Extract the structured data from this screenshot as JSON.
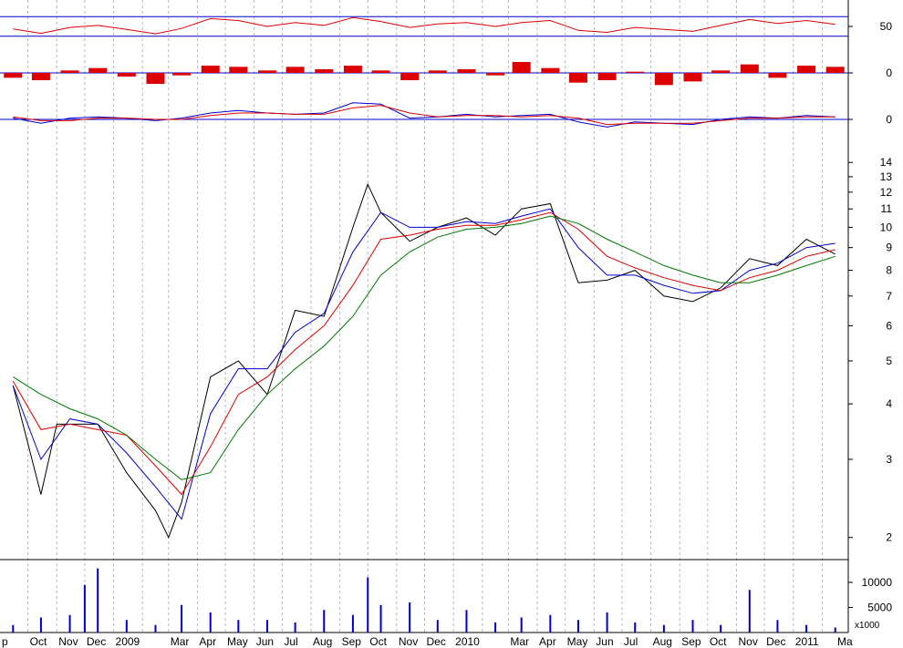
{
  "chart_data": [
    {
      "panel": "rsi",
      "type": "line",
      "y_ticks": [
        50
      ],
      "ylim": [
        0,
        100
      ],
      "reference_levels": [
        30,
        70
      ],
      "series": [
        {
          "color": "#dd0000",
          "x": [
            "2008-09-15",
            "2008-10-15",
            "2008-11-15",
            "2008-12-15",
            "2009-01-15",
            "2009-02-15",
            "2009-03-15",
            "2009-04-15",
            "2009-05-15",
            "2009-06-15",
            "2009-07-15",
            "2009-08-15",
            "2009-09-15",
            "2009-10-15",
            "2009-11-15",
            "2009-12-15",
            "2010-01-15",
            "2010-02-15",
            "2010-03-15",
            "2010-04-15",
            "2010-05-15",
            "2010-06-15",
            "2010-07-15",
            "2010-08-15",
            "2010-09-15",
            "2010-10-15",
            "2010-11-15",
            "2010-12-15",
            "2011-01-15",
            "2011-02-15"
          ],
          "values": [
            45,
            36,
            48,
            52,
            44,
            35,
            46,
            66,
            62,
            50,
            58,
            52,
            68,
            60,
            48,
            55,
            58,
            50,
            58,
            62,
            42,
            38,
            48,
            44,
            40,
            52,
            64,
            56,
            62,
            54
          ]
        }
      ]
    },
    {
      "panel": "macd-histogram",
      "type": "bar",
      "y_ticks": [
        0
      ],
      "ylim": [
        -1.5,
        1.5
      ],
      "series": [
        {
          "color": "#dd0000",
          "x": [
            "2008-09-15",
            "2008-10-15",
            "2008-11-15",
            "2008-12-15",
            "2009-01-15",
            "2009-02-15",
            "2009-03-15",
            "2009-04-15",
            "2009-05-15",
            "2009-06-15",
            "2009-07-15",
            "2009-08-15",
            "2009-09-15",
            "2009-10-15",
            "2009-11-15",
            "2009-12-15",
            "2010-01-15",
            "2010-02-15",
            "2010-03-15",
            "2010-04-15",
            "2010-05-15",
            "2010-06-15",
            "2010-07-15",
            "2010-08-15",
            "2010-09-15",
            "2010-10-15",
            "2010-11-15",
            "2010-12-15",
            "2011-01-15",
            "2011-02-15"
          ],
          "values": [
            -0.4,
            -0.6,
            0.2,
            0.4,
            -0.3,
            -0.9,
            -0.2,
            0.6,
            0.5,
            0.2,
            0.5,
            0.3,
            0.6,
            0.2,
            -0.6,
            0.2,
            0.3,
            -0.2,
            0.9,
            0.4,
            -0.8,
            -0.6,
            0.1,
            -1.0,
            -0.7,
            0.2,
            0.7,
            -0.4,
            0.6,
            0.5
          ]
        }
      ]
    },
    {
      "panel": "macd",
      "type": "line",
      "y_ticks": [
        0
      ],
      "ylim": [
        -1,
        2
      ],
      "series": [
        {
          "color": "#0000cc",
          "x": [
            "2008-09-15",
            "2008-10-15",
            "2008-11-15",
            "2008-12-15",
            "2009-01-15",
            "2009-02-15",
            "2009-03-15",
            "2009-04-15",
            "2009-05-15",
            "2009-06-15",
            "2009-07-15",
            "2009-08-15",
            "2009-09-15",
            "2009-10-15",
            "2009-11-15",
            "2009-12-15",
            "2010-01-15",
            "2010-02-15",
            "2010-03-15",
            "2010-04-15",
            "2010-05-15",
            "2010-06-15",
            "2010-07-15",
            "2010-08-15",
            "2010-09-15",
            "2010-10-15",
            "2010-11-15",
            "2010-12-15",
            "2011-01-15",
            "2011-02-15"
          ],
          "values": [
            0.1,
            -0.3,
            0.1,
            0.2,
            0.1,
            -0.1,
            0.1,
            0.5,
            0.7,
            0.5,
            0.4,
            0.5,
            1.3,
            1.2,
            0.1,
            0.2,
            0.4,
            0.2,
            0.3,
            0.4,
            -0.2,
            -0.6,
            -0.2,
            -0.3,
            -0.4,
            0.0,
            0.2,
            0.1,
            0.3,
            0.2
          ]
        },
        {
          "color": "#dd0000",
          "x": [
            "2008-09-15",
            "2008-10-15",
            "2008-11-15",
            "2008-12-15",
            "2009-01-15",
            "2009-02-15",
            "2009-03-15",
            "2009-04-15",
            "2009-05-15",
            "2009-06-15",
            "2009-07-15",
            "2009-08-15",
            "2009-09-15",
            "2009-10-15",
            "2009-11-15",
            "2009-12-15",
            "2010-01-15",
            "2010-02-15",
            "2010-03-15",
            "2010-04-15",
            "2010-05-15",
            "2010-06-15",
            "2010-07-15",
            "2010-08-15",
            "2010-09-15",
            "2010-10-15",
            "2010-11-15",
            "2010-12-15",
            "2011-01-15",
            "2011-02-15"
          ],
          "values": [
            0.2,
            -0.1,
            -0.1,
            0.1,
            0.1,
            0.0,
            0.0,
            0.3,
            0.5,
            0.5,
            0.4,
            0.4,
            0.9,
            1.1,
            0.5,
            0.2,
            0.3,
            0.3,
            0.2,
            0.3,
            0.1,
            -0.4,
            -0.3,
            -0.3,
            -0.3,
            -0.1,
            0.1,
            0.1,
            0.2,
            0.2
          ]
        }
      ]
    },
    {
      "panel": "price",
      "type": "line",
      "log_scale": true,
      "ylim": [
        1.8,
        16
      ],
      "y_ticks": [
        2,
        3,
        4,
        5,
        6,
        7,
        8,
        9,
        10,
        11,
        12,
        13,
        14
      ],
      "grid": "vertical dashed at months",
      "series": [
        {
          "color": "#000000",
          "x": [
            "2008-09-15",
            "2008-10-15",
            "2008-11-01",
            "2008-11-15",
            "2008-12-15",
            "2009-01-15",
            "2009-02-15",
            "2009-03-01",
            "2009-03-15",
            "2009-04-15",
            "2009-05-15",
            "2009-06-15",
            "2009-07-15",
            "2009-08-15",
            "2009-09-15",
            "2009-10-01",
            "2009-10-15",
            "2009-11-15",
            "2009-12-15",
            "2010-01-15",
            "2010-02-15",
            "2010-03-15",
            "2010-04-15",
            "2010-05-15",
            "2010-06-15",
            "2010-07-15",
            "2010-08-15",
            "2010-09-15",
            "2010-10-15",
            "2010-11-15",
            "2010-12-15",
            "2011-01-15",
            "2011-02-15"
          ],
          "values": [
            4.4,
            2.5,
            3.6,
            3.6,
            3.6,
            2.8,
            2.3,
            2.0,
            2.4,
            4.6,
            5.0,
            4.2,
            6.5,
            6.3,
            10.0,
            12.5,
            10.8,
            9.3,
            10.0,
            10.5,
            9.6,
            11.0,
            11.3,
            7.5,
            7.6,
            8.0,
            7.0,
            6.8,
            7.3,
            8.5,
            8.2,
            9.4,
            8.7
          ]
        },
        {
          "color": "#0000cc",
          "x": [
            "2008-09-15",
            "2008-10-15",
            "2008-11-15",
            "2008-12-15",
            "2009-01-15",
            "2009-02-15",
            "2009-03-15",
            "2009-04-15",
            "2009-05-15",
            "2009-06-15",
            "2009-07-15",
            "2009-08-15",
            "2009-09-15",
            "2009-10-15",
            "2009-11-15",
            "2009-12-15",
            "2010-01-15",
            "2010-02-15",
            "2010-03-15",
            "2010-04-15",
            "2010-05-15",
            "2010-06-15",
            "2010-07-15",
            "2010-08-15",
            "2010-09-15",
            "2010-10-15",
            "2010-11-15",
            "2010-12-15",
            "2011-01-15",
            "2011-02-15"
          ],
          "values": [
            4.4,
            3.0,
            3.7,
            3.6,
            3.1,
            2.6,
            2.2,
            3.8,
            4.8,
            4.8,
            5.8,
            6.4,
            8.8,
            10.8,
            10.0,
            10.0,
            10.3,
            10.2,
            10.6,
            11.0,
            9.0,
            7.8,
            7.8,
            7.4,
            7.1,
            7.2,
            8.0,
            8.3,
            9.0,
            9.2
          ]
        },
        {
          "color": "#dd0000",
          "x": [
            "2008-09-15",
            "2008-10-15",
            "2008-11-15",
            "2008-12-15",
            "2009-01-15",
            "2009-02-15",
            "2009-03-15",
            "2009-04-15",
            "2009-05-15",
            "2009-06-15",
            "2009-07-15",
            "2009-08-15",
            "2009-09-15",
            "2009-10-15",
            "2009-11-15",
            "2009-12-15",
            "2010-01-15",
            "2010-02-15",
            "2010-03-15",
            "2010-04-15",
            "2010-05-15",
            "2010-06-15",
            "2010-07-15",
            "2010-08-15",
            "2010-09-15",
            "2010-10-15",
            "2010-11-15",
            "2010-12-15",
            "2011-01-15",
            "2011-02-15"
          ],
          "values": [
            4.5,
            3.5,
            3.6,
            3.5,
            3.4,
            2.9,
            2.5,
            3.2,
            4.2,
            4.6,
            5.3,
            6.0,
            7.4,
            9.4,
            9.6,
            9.9,
            10.1,
            10.1,
            10.4,
            10.8,
            9.9,
            8.6,
            8.1,
            7.7,
            7.4,
            7.2,
            7.7,
            8.0,
            8.6,
            8.9
          ]
        },
        {
          "color": "#007700",
          "x": [
            "2008-09-15",
            "2008-10-15",
            "2008-11-15",
            "2008-12-15",
            "2009-01-15",
            "2009-02-15",
            "2009-03-15",
            "2009-04-15",
            "2009-05-15",
            "2009-06-15",
            "2009-07-15",
            "2009-08-15",
            "2009-09-15",
            "2009-10-15",
            "2009-11-15",
            "2009-12-15",
            "2010-01-15",
            "2010-02-15",
            "2010-03-15",
            "2010-04-15",
            "2010-05-15",
            "2010-06-15",
            "2010-07-15",
            "2010-08-15",
            "2010-09-15",
            "2010-10-15",
            "2010-11-15",
            "2010-12-15",
            "2011-01-15",
            "2011-02-15"
          ],
          "values": [
            4.6,
            4.2,
            3.9,
            3.7,
            3.4,
            3.0,
            2.7,
            2.8,
            3.5,
            4.2,
            4.8,
            5.4,
            6.3,
            7.8,
            8.8,
            9.5,
            9.9,
            10.0,
            10.2,
            10.6,
            10.2,
            9.4,
            8.8,
            8.2,
            7.8,
            7.5,
            7.5,
            7.8,
            8.2,
            8.6
          ]
        }
      ]
    },
    {
      "panel": "volume",
      "type": "bar",
      "ylim": [
        0,
        14000
      ],
      "y_ticks": [
        5000,
        10000
      ],
      "unit_label": "x1000",
      "series": [
        {
          "color": "#0000cc",
          "x": [
            "2008-09-15",
            "2008-10-15",
            "2008-11-15",
            "2008-12-01",
            "2008-12-15",
            "2009-01-15",
            "2009-02-15",
            "2009-03-15",
            "2009-04-15",
            "2009-05-15",
            "2009-06-15",
            "2009-07-15",
            "2009-08-15",
            "2009-09-15",
            "2009-10-01",
            "2009-10-15",
            "2009-11-15",
            "2009-12-15",
            "2010-01-15",
            "2010-02-15",
            "2010-03-15",
            "2010-04-15",
            "2010-05-15",
            "2010-06-15",
            "2010-07-15",
            "2010-08-15",
            "2010-09-15",
            "2010-10-15",
            "2010-11-15",
            "2010-12-15",
            "2011-01-15",
            "2011-02-15"
          ],
          "values": [
            1500,
            3000,
            3500,
            9500,
            12800,
            2500,
            1500,
            5500,
            4000,
            2500,
            2500,
            2000,
            4500,
            3500,
            11000,
            5500,
            6000,
            2500,
            4500,
            2000,
            3000,
            3500,
            2500,
            4000,
            2000,
            1500,
            2500,
            1500,
            8500,
            2500,
            1500,
            1000
          ]
        }
      ]
    },
    {
      "panel": "time-axis",
      "type": "line",
      "x_tick_labels": [
        "p",
        "Oct",
        "Nov",
        "Dec",
        "2009",
        "Mar",
        "Apr",
        "May",
        "Jun",
        "Jul",
        "Aug",
        "Sep",
        "Oct",
        "Nov",
        "Dec",
        "2010",
        "Mar",
        "Apr",
        "May",
        "Jun",
        "Jul",
        "Aug",
        "Sep",
        "Oct",
        "Nov",
        "Dec",
        "2011",
        "Ma"
      ],
      "x_tick_dates": [
        "2008-09-01",
        "2008-10-01",
        "2008-11-01",
        "2008-12-01",
        "2009-01-01",
        "2009-03-01",
        "2009-04-01",
        "2009-05-01",
        "2009-06-01",
        "2009-07-01",
        "2009-08-01",
        "2009-09-01",
        "2009-10-01",
        "2009-11-01",
        "2009-12-01",
        "2010-01-01",
        "2010-03-01",
        "2010-04-01",
        "2010-05-01",
        "2010-06-01",
        "2010-07-01",
        "2010-08-01",
        "2010-09-01",
        "2010-10-01",
        "2010-11-01",
        "2010-12-01",
        "2011-01-01",
        "2011-03-01"
      ],
      "grid_dates": [
        "2008-10-01",
        "2008-11-01",
        "2008-12-01",
        "2009-01-01",
        "2009-02-01",
        "2009-03-01",
        "2009-04-01",
        "2009-05-01",
        "2009-06-01",
        "2009-07-01",
        "2009-08-01",
        "2009-09-01",
        "2009-10-01",
        "2009-11-01",
        "2009-12-01",
        "2010-01-01",
        "2010-02-01",
        "2010-03-01",
        "2010-04-01",
        "2010-05-01",
        "2010-06-01",
        "2010-07-01",
        "2010-08-01",
        "2010-09-01",
        "2010-10-01",
        "2010-11-01",
        "2010-12-01",
        "2011-01-01",
        "2011-02-01"
      ],
      "xlim": [
        "2008-09-01",
        "2011-03-01"
      ]
    }
  ]
}
